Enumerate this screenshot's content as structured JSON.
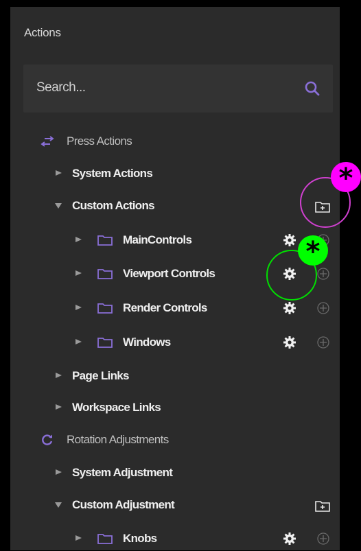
{
  "panel": {
    "title": "Actions"
  },
  "search": {
    "placeholder": "Search..."
  },
  "tree": {
    "press_actions": "Press Actions",
    "system_actions": "System Actions",
    "custom_actions": "Custom Actions",
    "main_controls": "MainControls",
    "viewport_controls": "Viewport Controls",
    "render_controls": "Render Controls",
    "windows": "Windows",
    "page_links": "Page Links",
    "workspace_links": "Workspace Links",
    "rotation_adjustments": "Rotation Adjustments",
    "system_adjustment": "System Adjustment",
    "custom_adjustment": "Custom Adjustment",
    "knobs": "Knobs"
  },
  "icons": {
    "search": "search-icon",
    "press": "swap-arrows-icon",
    "rotation": "rotate-icon",
    "folder": "folder-icon",
    "new_folder": "new-folder-icon",
    "settings": "gear-icon",
    "add": "add-circle-icon",
    "collapsed": "caret-right-icon",
    "expanded": "caret-down-icon"
  },
  "annotations": [
    {
      "marker": "*",
      "color": "#ff00ff",
      "target": "new-folder-button"
    },
    {
      "marker": "*",
      "color": "#00ff00",
      "target": "viewport-controls-settings"
    }
  ],
  "colors": {
    "background": "#000000",
    "panel": "#2b2b2b",
    "search_field": "#333333",
    "accent": "#8a6fd8",
    "text": "#efefef",
    "muted_text": "#bfbfbf",
    "highlight_magenta": "#ff00ff",
    "highlight_green": "#00ff00"
  }
}
